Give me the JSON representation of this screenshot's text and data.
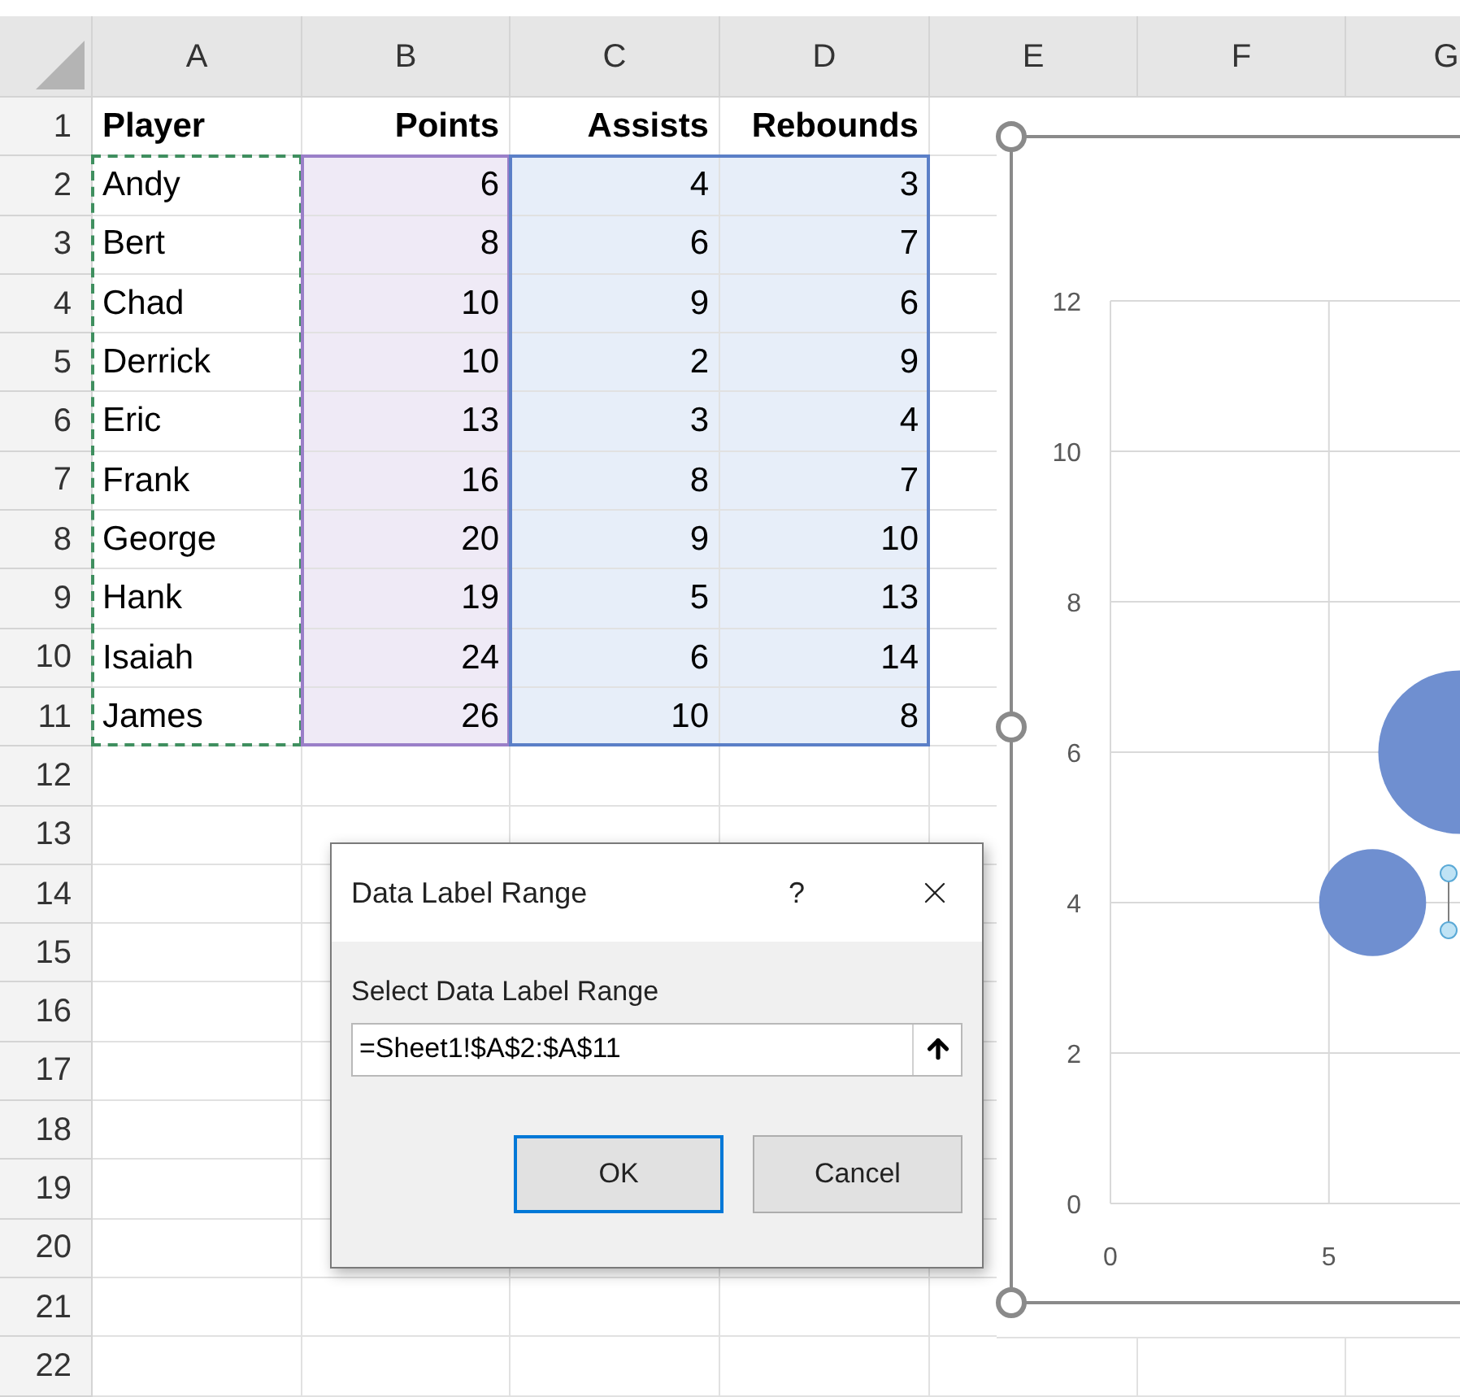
{
  "sheet": {
    "columns": [
      {
        "letter": "A",
        "kind": "labels"
      },
      {
        "letter": "B",
        "kind": "xvalues"
      },
      {
        "letter": "C",
        "kind": "yvalues"
      },
      {
        "letter": "D",
        "kind": "yvalues"
      },
      {
        "letter": "E",
        "kind": "plain"
      },
      {
        "letter": "F",
        "kind": "plain"
      },
      {
        "letter": "G",
        "kind": "plain"
      }
    ],
    "header": {
      "number": "1",
      "cells": [
        "Player",
        "Points",
        "Assists",
        "Rebounds"
      ]
    },
    "rows": [
      {
        "number": "2",
        "cells": [
          "Andy",
          "6",
          "4",
          "3"
        ]
      },
      {
        "number": "3",
        "cells": [
          "Bert",
          "8",
          "6",
          "7"
        ]
      },
      {
        "number": "4",
        "cells": [
          "Chad",
          "10",
          "9",
          "6"
        ]
      },
      {
        "number": "5",
        "cells": [
          "Derrick",
          "10",
          "2",
          "9"
        ]
      },
      {
        "number": "6",
        "cells": [
          "Eric",
          "13",
          "3",
          "4"
        ]
      },
      {
        "number": "7",
        "cells": [
          "Frank",
          "16",
          "8",
          "7"
        ]
      },
      {
        "number": "8",
        "cells": [
          "George",
          "20",
          "9",
          "10"
        ]
      },
      {
        "number": "9",
        "cells": [
          "Hank",
          "19",
          "5",
          "13"
        ]
      },
      {
        "number": "10",
        "cells": [
          "Isaiah",
          "24",
          "6",
          "14"
        ]
      },
      {
        "number": "11",
        "cells": [
          "James",
          "26",
          "10",
          "8"
        ]
      }
    ],
    "empty_rows": [
      "12",
      "13",
      "14",
      "15",
      "16",
      "17",
      "18",
      "19",
      "20",
      "21",
      "22"
    ]
  },
  "chart": {
    "chart_data": {
      "type": "scatter",
      "x": [
        6,
        8
      ],
      "series": [
        {
          "color": "#6f8fd0",
          "values": [
            4,
            6
          ]
        }
      ],
      "grid": true,
      "xlim": [
        0,
        8
      ],
      "ylim": [
        0,
        12
      ],
      "xticks": [
        0,
        5
      ],
      "yticks": [
        0,
        2,
        4,
        6,
        8,
        10,
        12
      ]
    }
  },
  "dialog": {
    "title": "Data Label Range",
    "help": "?",
    "field_label": "Select Data Label Range",
    "value": "=Sheet1!$A$2:$A$11",
    "buttons": [
      {
        "label": "OK",
        "default": true
      },
      {
        "label": "Cancel",
        "default": false
      }
    ]
  }
}
